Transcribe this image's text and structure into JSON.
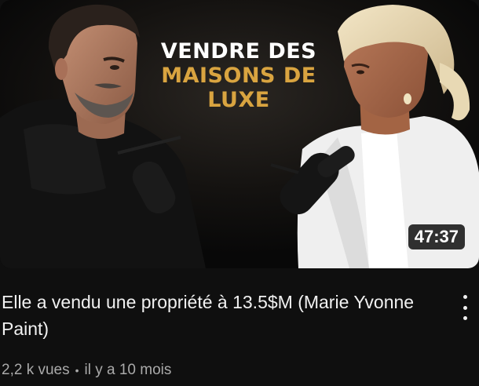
{
  "video": {
    "thumbnail": {
      "headline_line1": "VENDRE DES",
      "headline_line2": "MAISONS DE LUXE",
      "headline_accent_color": "#d9a440",
      "duration": "47:37"
    },
    "title": "Elle a vendu une propriété à 13.5$M (Marie Yvonne Paint)",
    "views": "2,2 k vues",
    "separator": "•",
    "published": "il y a 10 mois",
    "menu_icon": "more-vert-icon"
  }
}
